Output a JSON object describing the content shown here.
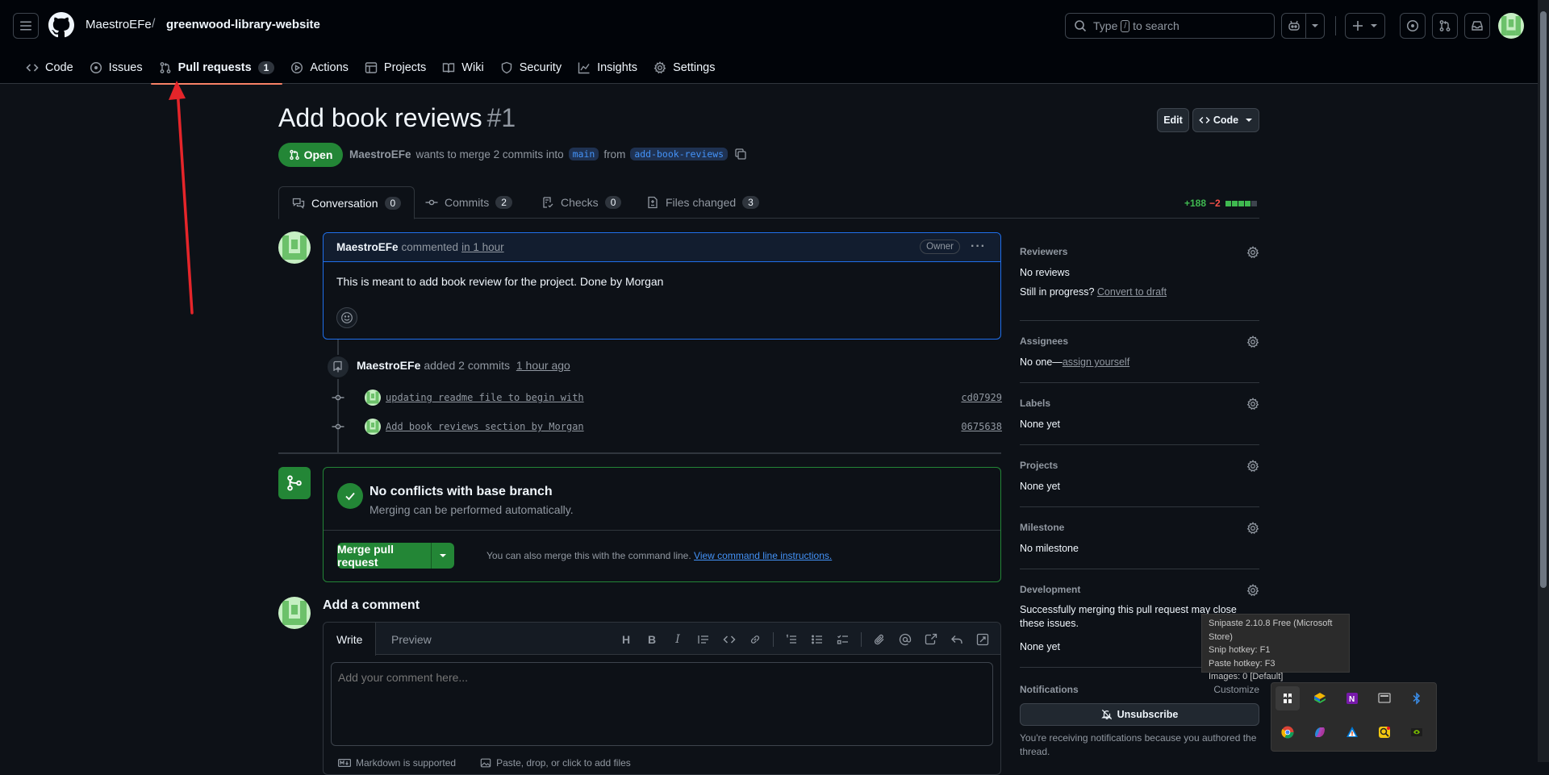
{
  "header": {
    "owner": "MaestroEFe",
    "separator": "/",
    "repo": "greenwood-library-website",
    "search_prefix": "Type",
    "search_key": "/",
    "search_suffix": "to search"
  },
  "repo_nav": {
    "code": "Code",
    "issues": "Issues",
    "pull_requests": "Pull requests",
    "pull_requests_count": "1",
    "actions": "Actions",
    "projects": "Projects",
    "wiki": "Wiki",
    "security": "Security",
    "insights": "Insights",
    "settings": "Settings"
  },
  "pr": {
    "title": "Add book reviews",
    "number": "#1",
    "edit_label": "Edit",
    "code_label": "Code",
    "state": "Open",
    "author": "MaestroEFe",
    "merge_text": "wants to merge 2 commits into",
    "base_branch": "main",
    "from_text": "from",
    "head_branch": "add-book-reviews"
  },
  "tabs": {
    "conversation": "Conversation",
    "conversation_count": "0",
    "commits": "Commits",
    "commits_count": "2",
    "checks": "Checks",
    "checks_count": "0",
    "files": "Files changed",
    "files_count": "3",
    "additions": "+188",
    "deletions": "−2"
  },
  "comment": {
    "author": "MaestroEFe",
    "action": "commented",
    "time": "in 1 hour",
    "badge": "Owner",
    "body": "This is meant to add book review for the project. Done by Morgan"
  },
  "timeline": {
    "author": "MaestroEFe",
    "action": "added 2 commits",
    "time": "1 hour ago",
    "commits": [
      {
        "message": "updating readme file to begin with",
        "sha": "cd07929"
      },
      {
        "message": "Add book reviews section by Morgan",
        "sha": "0675638"
      }
    ]
  },
  "merge": {
    "title": "No conflicts with base branch",
    "subtitle": "Merging can be performed automatically.",
    "button": "Merge pull request",
    "hint": "You can also merge this with the command line.",
    "hint_link": "View command line instructions."
  },
  "add_comment": {
    "title": "Add a comment",
    "write_tab": "Write",
    "preview_tab": "Preview",
    "placeholder": "Add your comment here...",
    "footer_markdown": "Markdown is supported",
    "footer_paste": "Paste, drop, or click to add files"
  },
  "sidebar": {
    "reviewers_title": "Reviewers",
    "reviewers_value": "No reviews",
    "progress_text": "Still in progress?",
    "progress_link": "Convert to draft",
    "assignees_title": "Assignees",
    "assignees_value": "No one—",
    "assignees_link": "assign yourself",
    "labels_title": "Labels",
    "labels_value": "None yet",
    "projects_title": "Projects",
    "projects_value": "None yet",
    "milestone_title": "Milestone",
    "milestone_value": "No milestone",
    "development_title": "Development",
    "development_text": "Successfully merging this pull request may close these issues.",
    "development_value": "None yet",
    "notifications_title": "Notifications",
    "customize": "Customize",
    "unsubscribe": "Unsubscribe",
    "notifications_text": "You're receiving notifications because you authored the thread."
  },
  "tooltip": {
    "line1": "Snipaste 2.10.8 Free (Microsoft Store)",
    "line2": "Snip hotkey: F1",
    "line3": "Paste hotkey: F3",
    "line4": "Images: 0 [Default]"
  },
  "colors": {
    "accent_green": "#238636",
    "link_blue": "#4493f8",
    "tab_underline": "#f78166",
    "annotation_red": "#e5252a"
  }
}
